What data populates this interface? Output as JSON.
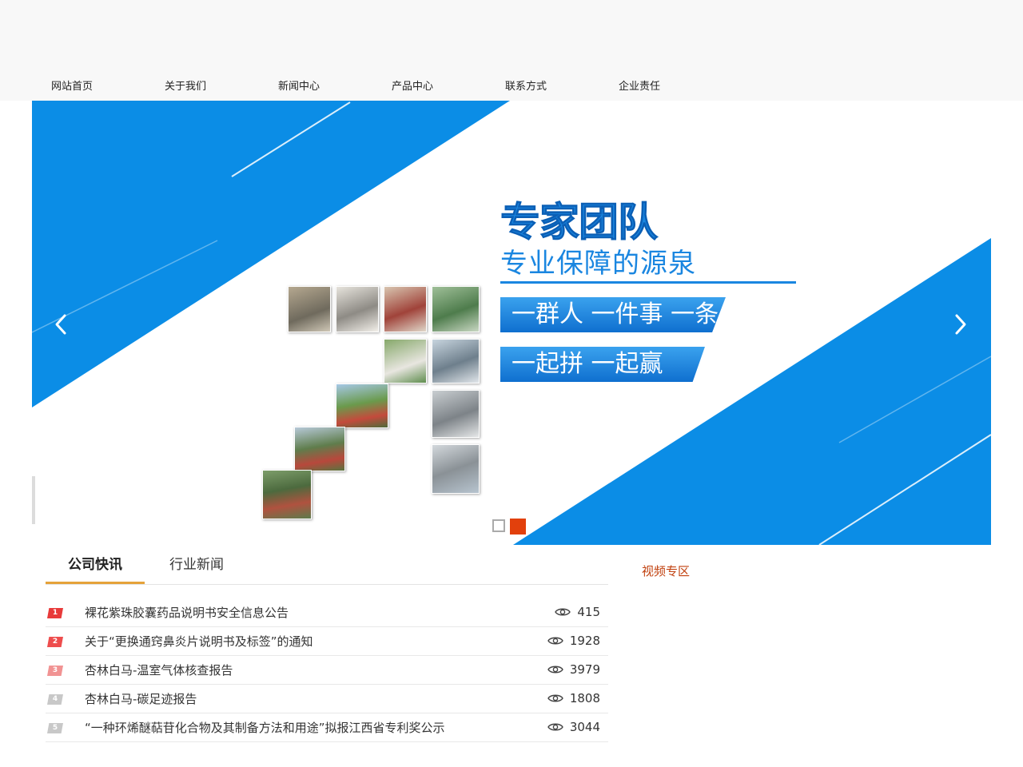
{
  "nav": {
    "items": [
      "网站首页",
      "关于我们",
      "新闻中心",
      "产品中心",
      "联系方式",
      "企业责任"
    ]
  },
  "banner": {
    "headline": "专家团队",
    "subline": "专业保障的源泉",
    "slogan1": "一群人 一件事 一条心",
    "slogan2": "一起拼 一起赢",
    "colors": {
      "blue": "#0b8de6",
      "accent": "#e2400c"
    },
    "slide_count": 2,
    "active_slide": 2
  },
  "news": {
    "tabs": [
      "公司快讯",
      "行业新闻"
    ],
    "active_tab": 0,
    "items": [
      {
        "rank": "1",
        "title": "裸花紫珠胶囊药品说明书安全信息公告",
        "views": "415",
        "rank_color": "#e83a3a"
      },
      {
        "rank": "2",
        "title": "关于“更换通窍鼻炎片说明书及标签”的通知",
        "views": "1928",
        "rank_color": "#ee4d4d"
      },
      {
        "rank": "3",
        "title": "杏林白马-温室气体核查报告",
        "views": "3979",
        "rank_color": "#f19393"
      },
      {
        "rank": "4",
        "title": "杏林白马-碳足迹报告",
        "views": "1808",
        "rank_color": "#c8c8c8"
      },
      {
        "rank": "5",
        "title": "“一种环烯醚萜苷化合物及其制备方法和用途”拟报江西省专利奖公示",
        "views": "3044",
        "rank_color": "#c8c8c8"
      }
    ]
  },
  "video": {
    "title": "视频专区"
  }
}
